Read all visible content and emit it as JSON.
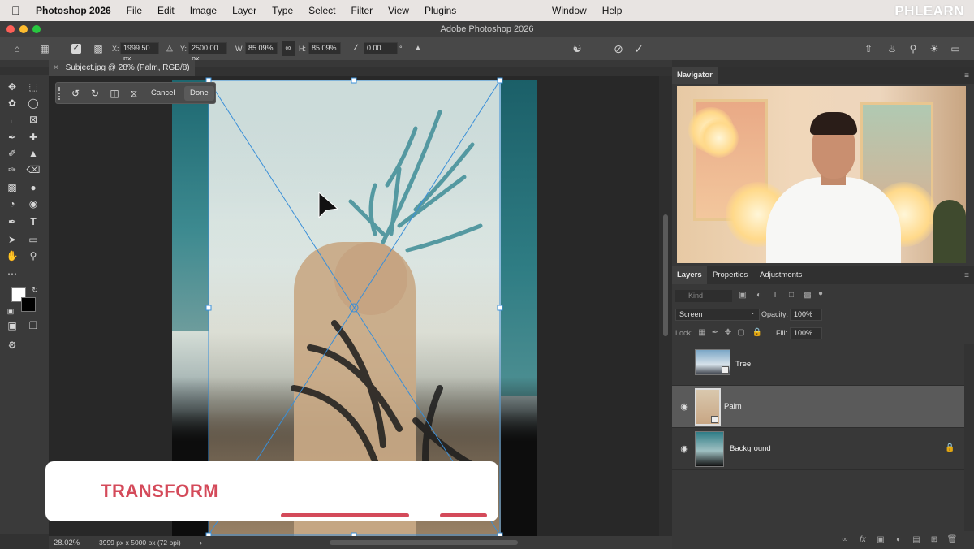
{
  "menubar": {
    "app": "Photoshop 2026",
    "items": [
      "File",
      "Edit",
      "Image",
      "Layer",
      "Type",
      "Select",
      "Filter",
      "View",
      "Plugins"
    ],
    "right_items": [
      "Window",
      "Help"
    ],
    "brand": "PHLEARN"
  },
  "window": {
    "title": "Adobe Photoshop 2026"
  },
  "options": {
    "x_label": "X:",
    "x_value": "1999.50 px",
    "y_label": "Y:",
    "y_value": "2500.00 px",
    "w_label": "W:",
    "w_value": "85.09%",
    "h_label": "H:",
    "h_value": "85.09%",
    "angle_value": "0.00",
    "angle_unit": "°"
  },
  "document": {
    "tab_label": "Subject.jpg @ 28% (Palm, RGB/8) *"
  },
  "transform_bar": {
    "cancel_label": "Cancel",
    "done_label": "Done"
  },
  "overlay": {
    "title": "TRANSFORM"
  },
  "status": {
    "zoom": "28.02%",
    "doc_info": "3999 px x 5000 px (72 ppi)",
    "arrow": "›"
  },
  "navigator": {
    "title": "Navigator"
  },
  "layers_panel": {
    "tabs": [
      "Layers",
      "Properties",
      "Adjustments"
    ],
    "kind_placeholder": "Kind",
    "blend_mode": "Screen",
    "opacity_label": "Opacity:",
    "opacity_value": "100%",
    "lock_label": "Lock:",
    "fill_label": "Fill:",
    "fill_value": "100%",
    "layers": [
      {
        "name": "Tree",
        "visible": false,
        "selected": false,
        "locked": false
      },
      {
        "name": "Palm",
        "visible": true,
        "selected": true,
        "locked": false
      },
      {
        "name": "Background",
        "visible": true,
        "selected": false,
        "locked": true
      }
    ]
  },
  "colors": {
    "accent_red": "#d44a5a",
    "selection_blue": "#3a8fd8",
    "foreground": "#ffffff",
    "background": "#000000"
  }
}
